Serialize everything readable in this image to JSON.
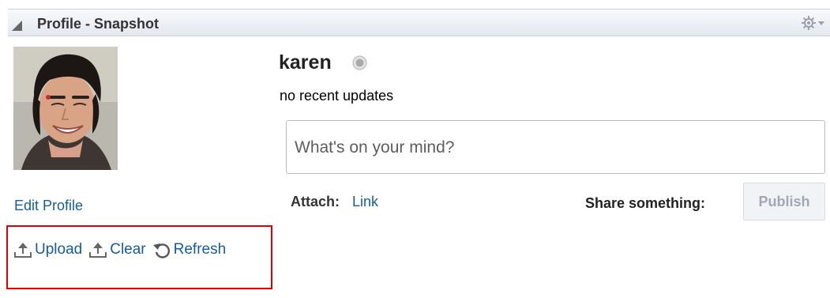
{
  "header": {
    "title": "Profile - Snapshot",
    "collapse_icon": "collapse-triangle-icon",
    "menu_icon": "gear-dropdown-icon"
  },
  "profile": {
    "username": "karen",
    "presence_icon": "presence-status-icon",
    "status": "no recent updates",
    "edit_profile": "Edit Profile"
  },
  "composer": {
    "placeholder": "What's on your mind?",
    "attach_label": "Attach:",
    "attach_link": "Link",
    "share_label": "Share something:",
    "publish_label": "Publish"
  },
  "photo_actions": {
    "upload": "Upload",
    "clear": "Clear",
    "refresh": "Refresh"
  },
  "colors": {
    "link": "#145c9e",
    "highlight": "#e00000",
    "header_bg": "#e3e8ef",
    "disabled_text": "#a3a8b0"
  }
}
